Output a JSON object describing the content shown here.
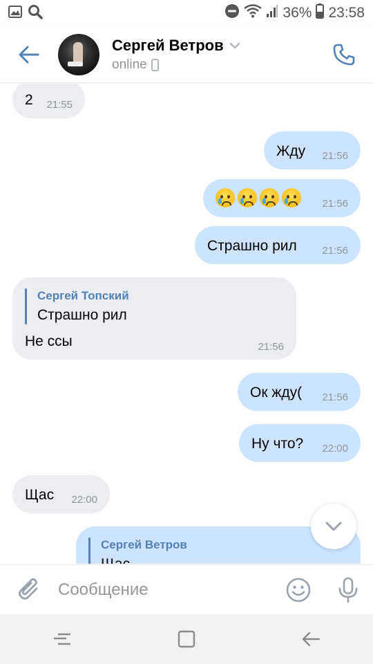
{
  "status_bar": {
    "battery": "36%",
    "time": "23:58"
  },
  "header": {
    "contact_name": "Сергей Ветров",
    "status": "online"
  },
  "messages": [
    {
      "dir": "in",
      "text": "2",
      "time": "21:55"
    },
    {
      "dir": "out",
      "text": "Жду",
      "time": "21:56"
    },
    {
      "dir": "out",
      "emoji": [
        "crying-face",
        "crying-face",
        "crying-face",
        "loudly-crying-face"
      ],
      "time": "21:56"
    },
    {
      "dir": "out",
      "text": "Страшно рил",
      "time": "21:56"
    },
    {
      "dir": "in",
      "reply_author": "Сергей Топский",
      "reply_text": "Страшно рил",
      "text": "Не ссы",
      "time": "21:56"
    },
    {
      "dir": "out",
      "text": "Ок жду(",
      "time": "21:56"
    },
    {
      "dir": "out",
      "text": "Ну что?",
      "time": "22:00"
    },
    {
      "dir": "in",
      "text": "Щас",
      "time": "22:00"
    },
    {
      "dir": "out",
      "reply_author": "Сергей Ветров",
      "reply_text": "Щас"
    }
  ],
  "composer": {
    "placeholder": "Сообщение"
  },
  "colors": {
    "accent": "#5181b8",
    "incoming_bubble": "#ebedf0",
    "outgoing_bubble": "#cce4ff",
    "secondary_text": "#939699"
  },
  "icons": {
    "back": "arrow-left-icon",
    "call": "phone-icon",
    "attach": "paperclip-icon",
    "emoji": "smile-icon",
    "mic": "microphone-icon",
    "scroll_down": "chevron-down-icon"
  }
}
